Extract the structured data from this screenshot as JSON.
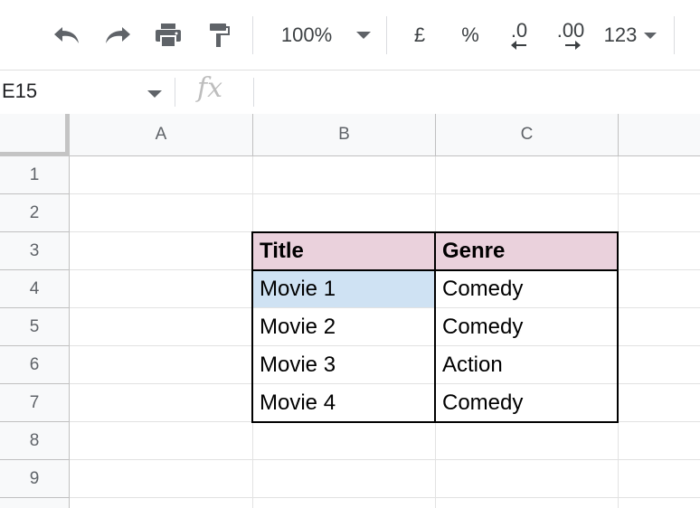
{
  "toolbar": {
    "undo_icon": "undo-icon",
    "redo_icon": "redo-icon",
    "print_icon": "print-icon",
    "paint_format_icon": "paint-format-icon",
    "zoom": "100%",
    "currency": "£",
    "percent": "%",
    "decrease_decimal": ".0",
    "increase_decimal": ".00",
    "more_formats": "123"
  },
  "formula_bar": {
    "name_box": "E15",
    "fx_label": "fx",
    "formula": ""
  },
  "grid": {
    "columns": [
      "A",
      "B",
      "C"
    ],
    "rows": [
      "1",
      "2",
      "3",
      "4",
      "5",
      "6",
      "7",
      "8",
      "9"
    ],
    "table": {
      "header": [
        "Title",
        "Genre"
      ],
      "rows": [
        [
          "Movie 1",
          "Comedy"
        ],
        [
          "Movie 2",
          "Comedy"
        ],
        [
          "Movie 3",
          "Action"
        ],
        [
          "Movie 4",
          "Comedy"
        ]
      ]
    }
  },
  "colors": {
    "header_fill": "#ead1dc",
    "selected_fill": "#cfe2f3"
  }
}
